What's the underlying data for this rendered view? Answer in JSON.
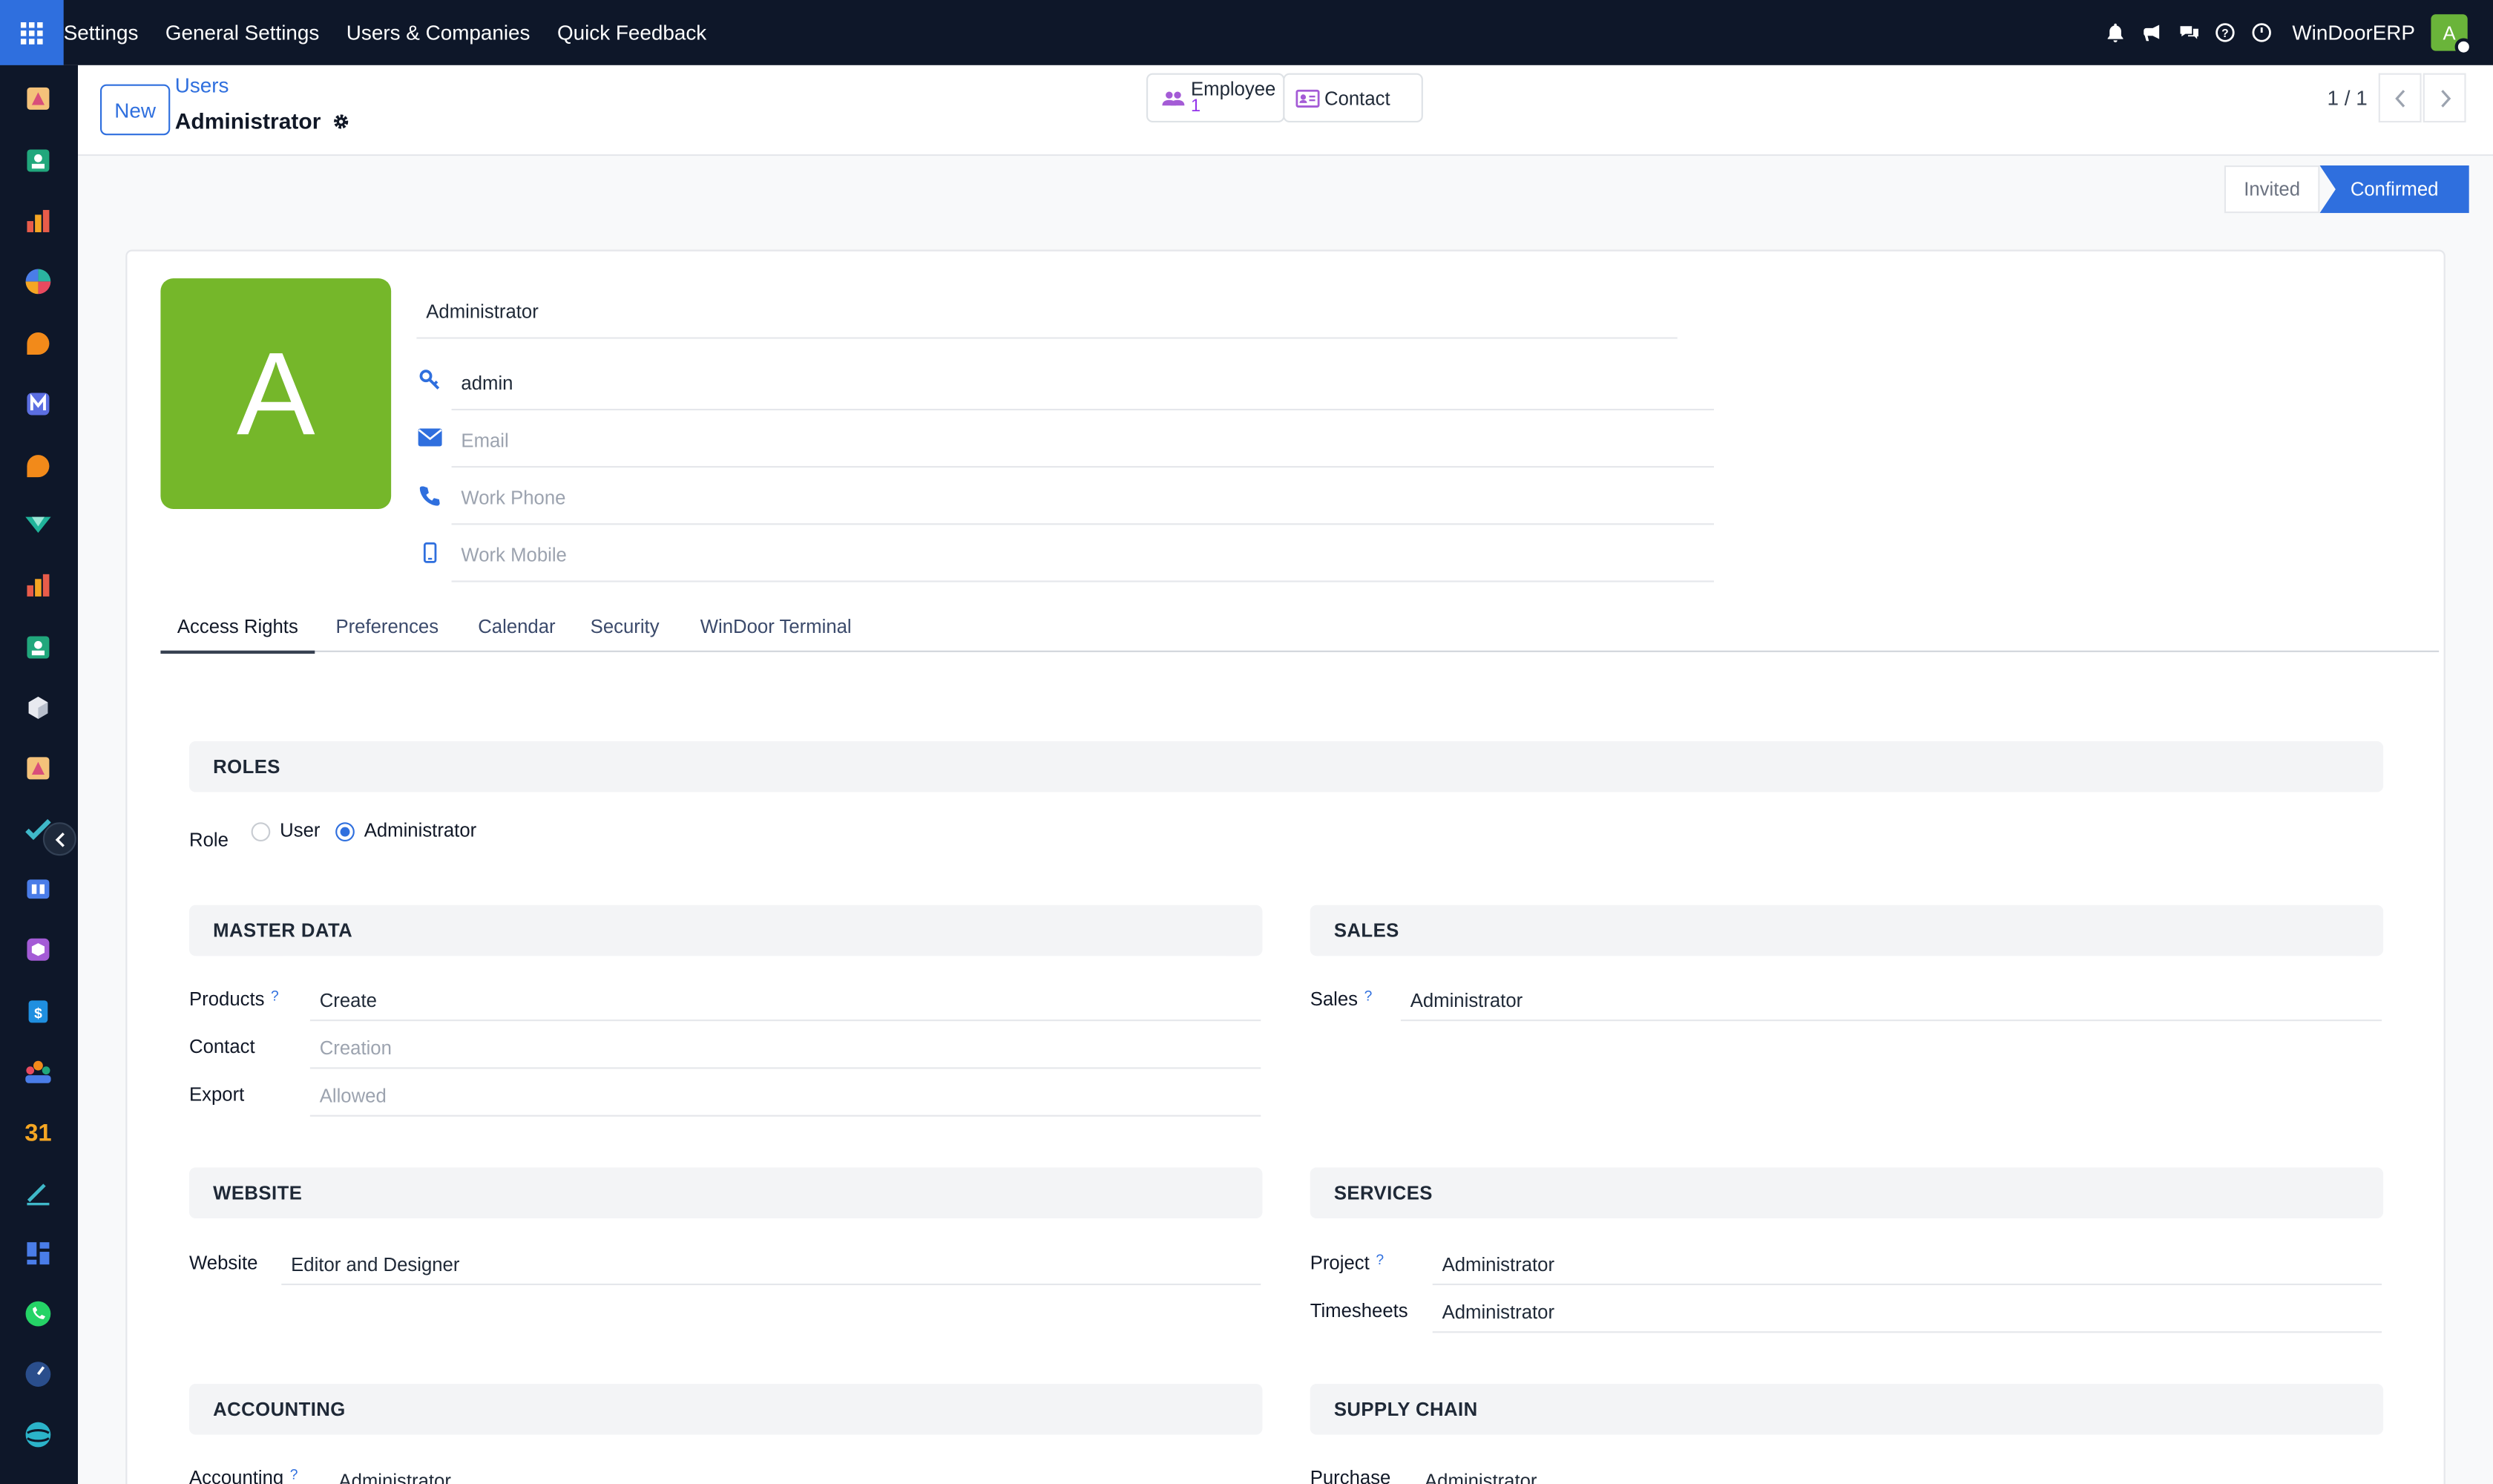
{
  "topbar": {
    "menu": [
      "Settings",
      "General Settings",
      "Users & Companies",
      "Quick Feedback"
    ],
    "company": "WinDoorERP",
    "avatar_letter": "A"
  },
  "breadcrumb": {
    "parent": "Users",
    "title": "Administrator"
  },
  "new_button": "New",
  "smart_buttons": {
    "employee_label": "Employee",
    "employee_count": "1",
    "contact_label": "Contact"
  },
  "pager": "1 / 1",
  "statusbar": {
    "invited": "Invited",
    "confirmed": "Confirmed"
  },
  "form": {
    "avatar_letter": "A",
    "name": "Administrator",
    "login": "admin",
    "email_placeholder": "Email",
    "phone_placeholder": "Work Phone",
    "mobile_placeholder": "Work Mobile"
  },
  "tabs": [
    "Access Rights",
    "Preferences",
    "Calendar",
    "Security",
    "WinDoor Terminal"
  ],
  "access": {
    "roles": {
      "title": "ROLES",
      "label": "Role",
      "options": [
        "User",
        "Administrator"
      ],
      "selected": "Administrator"
    },
    "master_data": {
      "title": "MASTER DATA",
      "products_label": "Products",
      "products_value": "Create",
      "contact_label": "Contact",
      "contact_placeholder": "Creation",
      "export_label": "Export",
      "export_placeholder": "Allowed"
    },
    "sales": {
      "title": "SALES",
      "label": "Sales",
      "value": "Administrator"
    },
    "website": {
      "title": "WEBSITE",
      "label": "Website",
      "value": "Editor and Designer"
    },
    "services": {
      "title": "SERVICES",
      "project_label": "Project",
      "project_value": "Administrator",
      "timesheets_label": "Timesheets",
      "timesheets_value": "Administrator"
    },
    "accounting": {
      "title": "ACCOUNTING",
      "label": "Accounting",
      "value": "Administrator"
    },
    "supply_chain": {
      "title": "SUPPLY CHAIN",
      "label": "Purchase",
      "value": "Administrator"
    }
  },
  "help_mark": "?",
  "colors": {
    "topbar": "#0e1729",
    "accent": "#2f6fde",
    "avatar": "#75b72a"
  },
  "sidebar_icons": [
    "discuss-app-icon",
    "contacts-app-icon",
    "dashboards-app-icon",
    "crm-app-icon",
    "chat-app-icon",
    "email-marketing-app-icon",
    "live-chat-app-icon",
    "sales-app-icon",
    "reporting-app-icon",
    "employees-app-icon",
    "inventory-app-icon",
    "knowledge-app-icon",
    "todo-app-icon",
    "elearning-app-icon",
    "purchase-app-icon",
    "invoicing-app-icon",
    "team-app-icon",
    "calendar-app-icon",
    "sign-app-icon",
    "website-app-icon",
    "whatsapp-app-icon",
    "timer-app-icon",
    "surveys-app-icon"
  ]
}
